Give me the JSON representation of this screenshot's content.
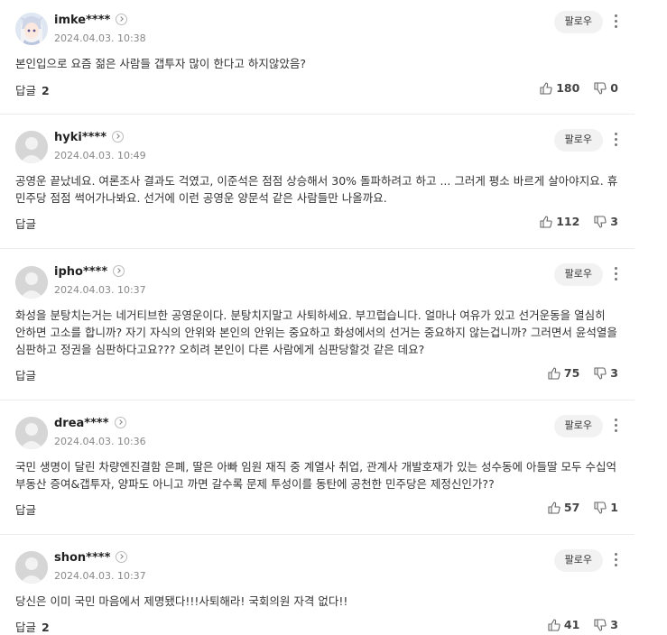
{
  "comments": [
    {
      "user": "imke****",
      "date": "2024.04.03. 10:38",
      "text": "본인입으로 요즘 젊은 사람들 갭투자 많이 한다고 하지않았음?",
      "reply_label": "답글",
      "reply_count": "2",
      "likes": "180",
      "dislikes": "0",
      "follow": "팔로우",
      "avatar": "anime-character-avatar"
    },
    {
      "user": "hyki****",
      "date": "2024.04.03. 10:49",
      "text": "공영운 끝났네요. 여론조사 결과도 걱였고, 이준석은 점점 상승해서 30% 돌파하려고 하고 ... 그러게 평소 바르게 살아야지요. 휴 민주당 점점 썩어가나봐요. 선거에 이런 공영운 양문석 같은 사람들만 나올까요.",
      "reply_label": "답글",
      "reply_count": "",
      "likes": "112",
      "dislikes": "3",
      "follow": "팔로우",
      "avatar": "default-avatar"
    },
    {
      "user": "ipho****",
      "date": "2024.04.03. 10:37",
      "text": "화성을 분탕치는거는 네거티브한 공영운이다. 분탕치지말고 사퇴하세요. 부끄럽습니다. 얼마나 여유가 있고 선거운동을 열심히 안하면 고소를 합니까? 자기 자식의 안위와 본인의 안위는 중요하고 화성에서의 선거는 중요하지 않는겁니까? 그러면서 윤석열을 심판하고 정권을 심판하다고요??? 오히려 본인이 다른 사람에게 심판당할것 같은 데요?",
      "reply_label": "답글",
      "reply_count": "",
      "likes": "75",
      "dislikes": "3",
      "follow": "팔로우",
      "avatar": "default-avatar"
    },
    {
      "user": "drea****",
      "date": "2024.04.03. 10:36",
      "text": "국민 생명이 달린 차량엔진결함 은폐, 딸은 아빠 임원 재직 중 계열사 취업, 관계사 개발호재가 있는 성수동에 아들딸 모두 수십억 부동산 증여&갭투자, 양파도 아니고 까면 갈수록 문제 투성이를 동탄에 공천한 민주당은 제정신인가??",
      "reply_label": "답글",
      "reply_count": "",
      "likes": "57",
      "dislikes": "1",
      "follow": "팔로우",
      "avatar": "default-avatar"
    },
    {
      "user": "shon****",
      "date": "2024.04.03. 10:37",
      "text": "당신은 이미 국민 마음에서 제명됐다!!!사퇴해라! 국회의원 자격 없다!!",
      "reply_label": "답글",
      "reply_count": "2",
      "likes": "41",
      "dislikes": "3",
      "follow": "팔로우",
      "avatar": "default-avatar"
    }
  ],
  "colors": {
    "accent": "#222222",
    "muted": "#888888",
    "divider": "#ececec",
    "follow_bg": "#f2f2f2"
  }
}
